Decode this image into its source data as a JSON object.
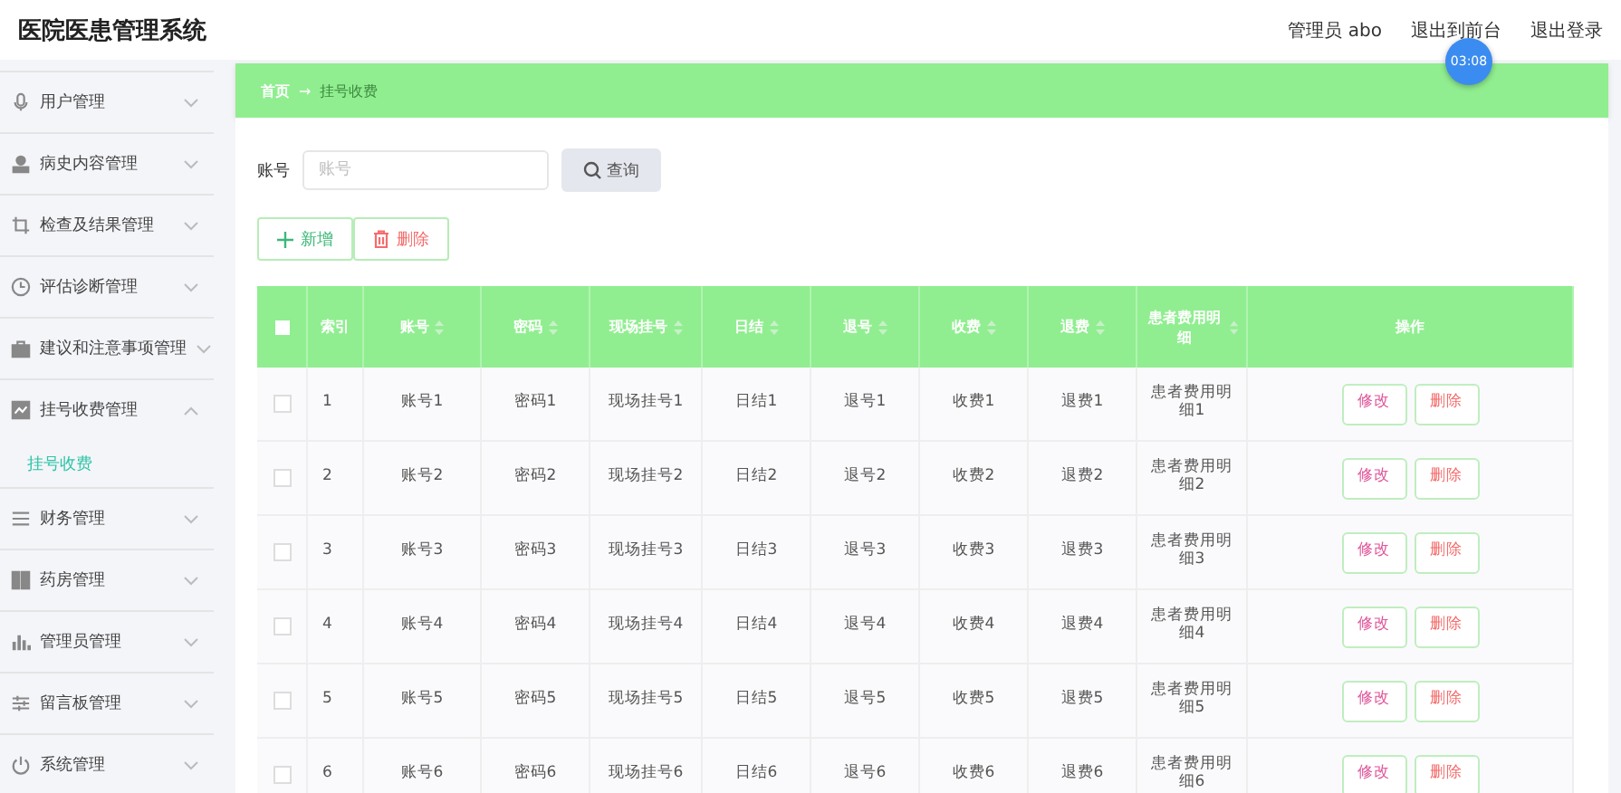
{
  "header": {
    "title": "医院医患管理系统",
    "user": "管理员 abo",
    "links": [
      "退出到前台",
      "退出登录"
    ],
    "timer": "03:08"
  },
  "sidebar": {
    "items": [
      {
        "label": "用户管理",
        "expanded": false
      },
      {
        "label": "病史内容管理",
        "expanded": false
      },
      {
        "label": "检查及结果管理",
        "expanded": false
      },
      {
        "label": "评估诊断管理",
        "expanded": false
      },
      {
        "label": "建议和注意事项管理",
        "expanded": false
      },
      {
        "label": "挂号收费管理",
        "expanded": true,
        "children": [
          {
            "label": "挂号收费",
            "selected": true
          }
        ]
      },
      {
        "label": "财务管理",
        "expanded": false
      },
      {
        "label": "药房管理",
        "expanded": false
      },
      {
        "label": "管理员管理",
        "expanded": false
      },
      {
        "label": "留言板管理",
        "expanded": false
      },
      {
        "label": "系统管理",
        "expanded": false
      }
    ]
  },
  "breadcrumb": [
    "首页",
    "→",
    "挂号收费"
  ],
  "search": {
    "label": "账号",
    "placeholder": "账号",
    "button": "查询"
  },
  "actions": [
    "新增",
    "删除"
  ],
  "table": {
    "select_all_checked": false,
    "columns": [
      {
        "label": "索引",
        "sortable": false
      },
      {
        "label": "账号",
        "sortable": true
      },
      {
        "label": "密码",
        "sortable": true
      },
      {
        "label": "现场挂号",
        "sortable": true
      },
      {
        "label": "日结",
        "sortable": true
      },
      {
        "label": "退号",
        "sortable": true
      },
      {
        "label": "收费",
        "sortable": true
      },
      {
        "label": "退费",
        "sortable": true
      },
      {
        "label": "患者费用明细",
        "sortable": true
      },
      {
        "label": "操作",
        "sortable": false
      }
    ],
    "rows": [
      {
        "checked": false,
        "cells": [
          "1",
          "账号1",
          "密码1",
          "现场挂号1",
          "日结1",
          "退号1",
          "收费1",
          "退费1",
          "患者费用明细1"
        ],
        "buttons": [
          "修改",
          "删除"
        ]
      },
      {
        "checked": false,
        "cells": [
          "2",
          "账号2",
          "密码2",
          "现场挂号2",
          "日结2",
          "退号2",
          "收费2",
          "退费2",
          "患者费用明细2"
        ],
        "buttons": [
          "修改",
          "删除"
        ]
      },
      {
        "checked": false,
        "cells": [
          "3",
          "账号3",
          "密码3",
          "现场挂号3",
          "日结3",
          "退号3",
          "收费3",
          "退费3",
          "患者费用明细3"
        ],
        "buttons": [
          "修改",
          "删除"
        ]
      },
      {
        "checked": false,
        "cells": [
          "4",
          "账号4",
          "密码4",
          "现场挂号4",
          "日结4",
          "退号4",
          "收费4",
          "退费4",
          "患者费用明细4"
        ],
        "buttons": [
          "修改",
          "删除"
        ]
      },
      {
        "checked": false,
        "cells": [
          "5",
          "账号5",
          "密码5",
          "现场挂号5",
          "日结5",
          "退号5",
          "收费5",
          "退费5",
          "患者费用明细5"
        ],
        "buttons": [
          "修改",
          "删除"
        ]
      },
      {
        "checked": false,
        "cells": [
          "6",
          "账号6",
          "密码6",
          "现场挂号6",
          "日结6",
          "退号6",
          "收费6",
          "退费6",
          "患者费用明细6"
        ],
        "buttons": [
          "修改",
          "删除"
        ]
      }
    ]
  }
}
